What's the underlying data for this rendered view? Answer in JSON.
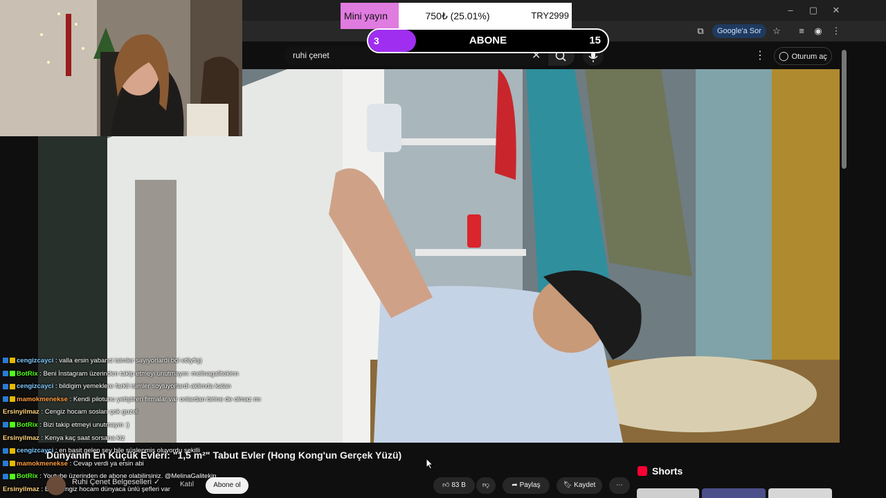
{
  "browser": {
    "google_sor": "Google'a Sor"
  },
  "header": {
    "search_value": "ruhi çenet",
    "signin_label": "Oturum aç"
  },
  "goal": {
    "mini_label": "Mini yayın",
    "amount": "750₺ (25.01%)",
    "target": "TRY2999"
  },
  "sub_goal": {
    "current": "3",
    "label": "ABONE",
    "target": "15",
    "progress": 0.2
  },
  "chat": [
    {
      "user": "cengizcayci",
      "color": "#7ec8ff",
      "badges": [
        "#2a7bd5",
        "#e6b800"
      ],
      "msg": ": valla ersin yabanci isimler sayiyorlardi bol etliyfiş)"
    },
    {
      "user": "BotRix",
      "color": "#53fc18",
      "badges": [
        "#2a7bd5",
        "#53fc18"
      ],
      "msg": ": Beni İnstagram üzerinden takip etmeyi unutmayın: melinagalitekinn"
    },
    {
      "user": "cengizcayci",
      "color": "#7ec8ff",
      "badges": [
        "#2a7bd5",
        "#e6b800"
      ],
      "msg": ": bildigim yemeklere farkli isimler soyluyorlardi aklimda kalan"
    },
    {
      "user": "mamokmenekse",
      "color": "#ff9a3c",
      "badges": [
        "#2a7bd5",
        "#e6b800"
      ],
      "msg": ": Kendi pilotunu yetiştiren firmalar var onlardan birine de olmaz mı"
    },
    {
      "user": "Ersinyilmaz",
      "color": "#ffd27a",
      "badges": [],
      "msg": ": Cengiz hocam sosları çok guzel"
    },
    {
      "user": "BotRix",
      "color": "#53fc18",
      "badges": [
        "#2a7bd5",
        "#53fc18"
      ],
      "msg": ": Bizi takip etmeyi unutmayın :)"
    },
    {
      "user": "Ersinyilmaz",
      "color": "#ffd27a",
      "badges": [],
      "msg": ": Kenya kaç saat sorsana kiz"
    },
    {
      "user": "cengizcayci",
      "color": "#7ec8ff",
      "badges": [
        "#2a7bd5",
        "#e6b800"
      ],
      "msg": ": en basit gelen şey bile süslenmiş oluyordu şekilli"
    },
    {
      "user": "mamokmenekse",
      "color": "#ff9a3c",
      "badges": [
        "#2a7bd5",
        "#e6b800"
      ],
      "msg": ": Cevap verdi ya ersin abi"
    },
    {
      "user": "BotRix",
      "color": "#53fc18",
      "badges": [
        "#2a7bd5",
        "#53fc18"
      ],
      "msg": ": Youtube üzerinden de abone olabilirsiniz. @MelinaGalitekin"
    },
    {
      "user": "Ersinyilmaz",
      "color": "#ffd27a",
      "badges": [],
      "msg": ": Eee cengiz hocam dünyaca ünlü şefleri var"
    }
  ],
  "video": {
    "title": "Dünyanın En Küçük Evleri: \"1,5 m²\" Tabut Evler (Hong Kong'un Gerçek Yüzü)",
    "channel": "Ruhi Çenet Belgeselleri",
    "join_label": "Katıl",
    "subscribe_label": "Abone ol",
    "likes": "83 B",
    "share_label": "Paylaş",
    "save_label": "Kaydet"
  },
  "sidebar": {
    "shorts_label": "Shorts"
  },
  "colors": {
    "subscribe_fill": "#a02ef0",
    "goal_pink": "#e07be0",
    "shorts_red": "#ff0033"
  }
}
